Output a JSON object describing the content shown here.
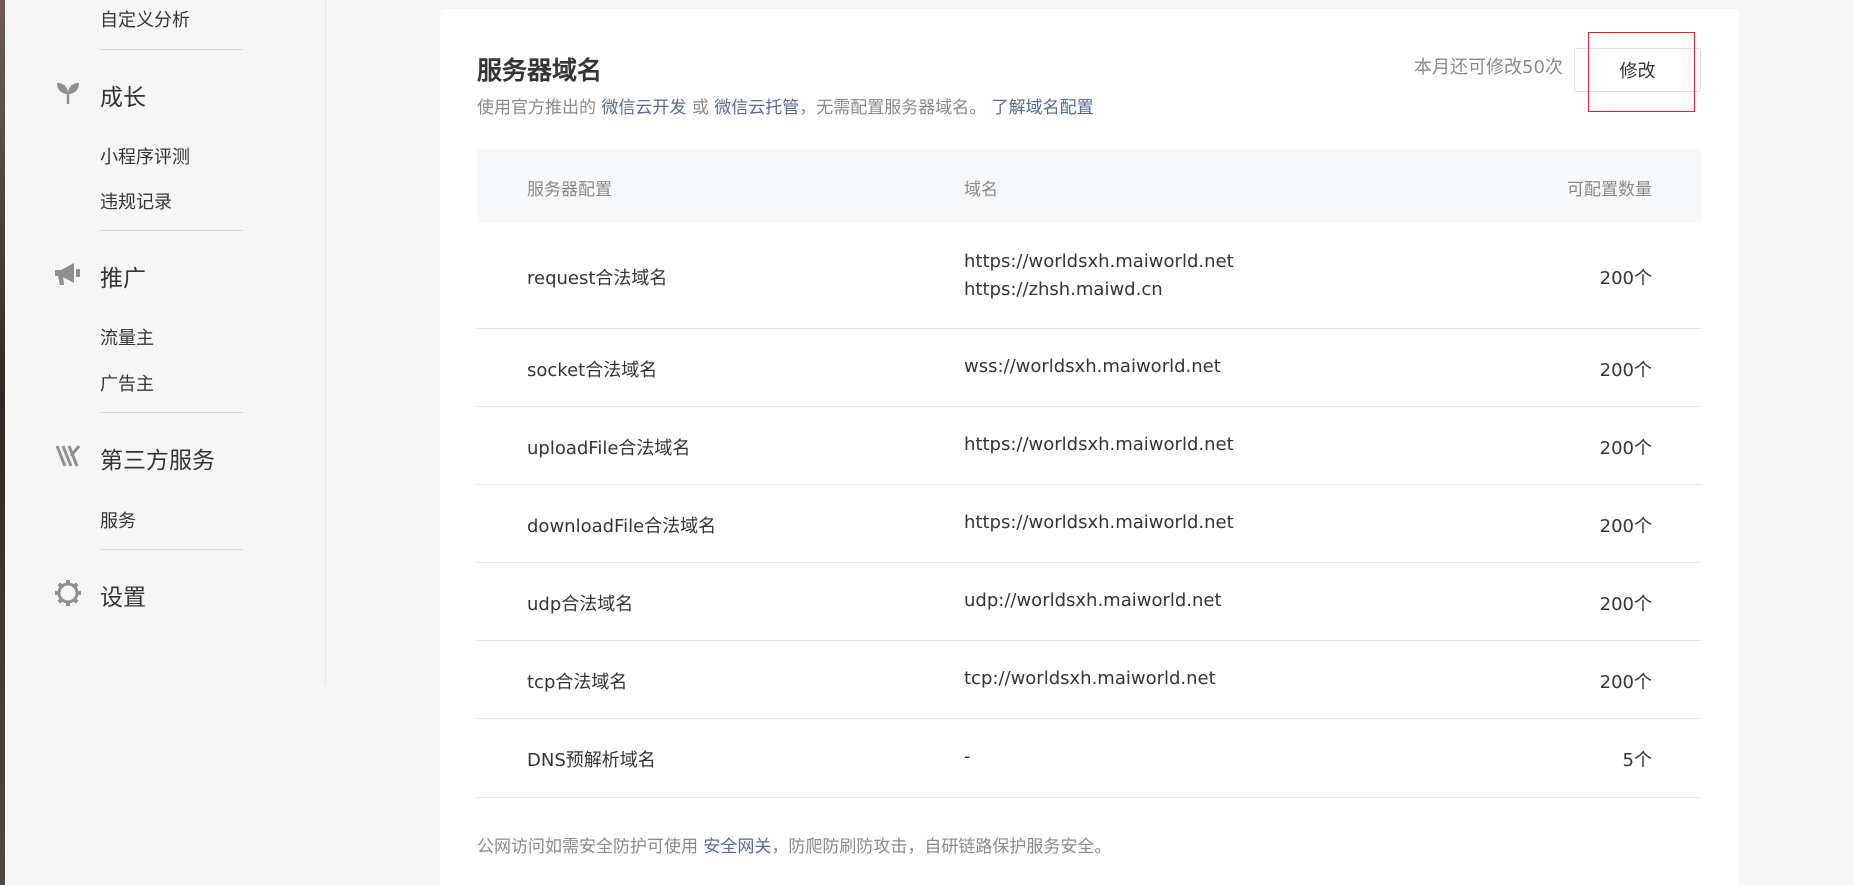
{
  "sidebar": {
    "items": [
      {
        "label": "自定义分析"
      },
      {
        "label": "成长",
        "icon": "sprout-icon"
      },
      {
        "label": "小程序评测"
      },
      {
        "label": "违规记录"
      },
      {
        "label": "推广",
        "icon": "megaphone-icon"
      },
      {
        "label": "流量主"
      },
      {
        "label": "广告主"
      },
      {
        "label": "第三方服务",
        "icon": "third-party-icon"
      },
      {
        "label": "服务"
      },
      {
        "label": "设置",
        "icon": "gear-icon"
      }
    ]
  },
  "header": {
    "title": "服务器域名",
    "desc_prefix": "使用官方推出的",
    "link_cloud_dev": "微信云开发",
    "desc_or": "或",
    "link_cloud_host": "微信云托管",
    "desc_suffix": "，无需配置服务器域名。",
    "link_learn": "了解域名配置",
    "quota_text": "本月还可修改50次",
    "edit_label": "修改"
  },
  "table": {
    "headers": [
      "服务器配置",
      "域名",
      "可配置数量"
    ],
    "rows": [
      {
        "config": "request合法域名",
        "domain1": "https://worldsxh.maiworld.net",
        "domain2": "https://zhsh.maiwd.cn",
        "count": "200个"
      },
      {
        "config": "socket合法域名",
        "domain1": "wss://worldsxh.maiworld.net",
        "count": "200个"
      },
      {
        "config": "uploadFile合法域名",
        "domain1": "https://worldsxh.maiworld.net",
        "count": "200个"
      },
      {
        "config": "downloadFile合法域名",
        "domain1": "https://worldsxh.maiworld.net",
        "count": "200个"
      },
      {
        "config": "udp合法域名",
        "domain1": "udp://worldsxh.maiworld.net",
        "count": "200个"
      },
      {
        "config": "tcp合法域名",
        "domain1": "tcp://worldsxh.maiworld.net",
        "count": "200个"
      },
      {
        "config": "DNS预解析域名",
        "domain1": "-",
        "count": "5个"
      }
    ]
  },
  "footer": {
    "prefix": "公网访问如需安全防护可使用",
    "link": "安全网关",
    "suffix": "，防爬防刷防攻击，自研链路保护服务安全。"
  },
  "colors": {
    "accent": "#576b95",
    "highlight_box": "#d9252e",
    "muted_text": "#8a8a8a",
    "primary_text": "#353535"
  }
}
